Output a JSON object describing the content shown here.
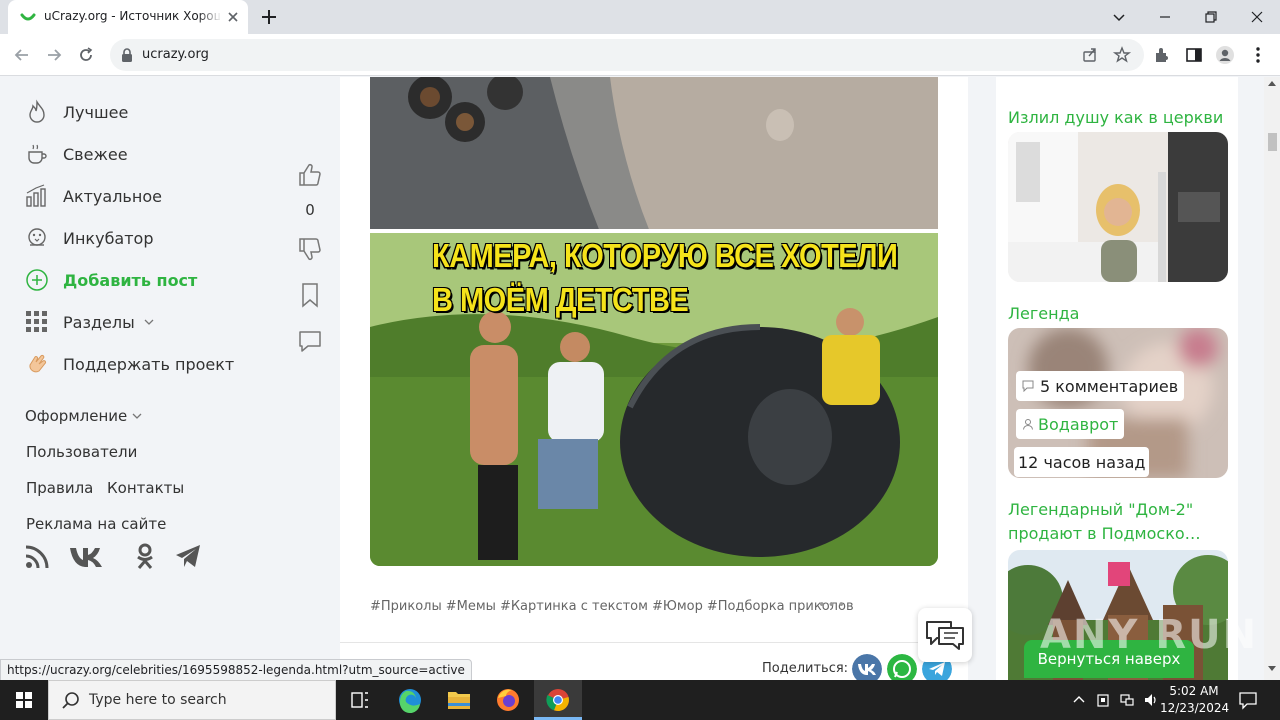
{
  "browser": {
    "tab_title": "uCrazy.org - Источник Хороше",
    "url": "ucrazy.org",
    "status_url": "https://ucrazy.org/celebrities/1695598852-legenda.html?utm_source=active"
  },
  "sidebar": {
    "items": [
      {
        "label": "Лучшее",
        "icon": "fire-icon"
      },
      {
        "label": "Свежее",
        "icon": "coffee-cup-icon"
      },
      {
        "label": "Актуальное",
        "icon": "bar-chart-icon"
      },
      {
        "label": "Инкубатор",
        "icon": "chick-icon"
      },
      {
        "label": "Добавить пост",
        "icon": "plus-circle-icon"
      },
      {
        "label": "Разделы",
        "icon": "grid-icon"
      },
      {
        "label": "Поддержать проект",
        "icon": "clap-hands-icon"
      }
    ],
    "design_label": "Оформление",
    "users_label": "Пользователи",
    "rules_label": "Правила",
    "contacts_label": "Контакты",
    "ads_label": "Реклама на сайте",
    "socials": [
      "rss-icon",
      "vk-icon",
      "odnoklassniki-icon",
      "telegram-icon"
    ]
  },
  "post": {
    "vote_count": "0",
    "caption_line1": "КАМЕРА, КОТОРУЮ ВСЕ ХОТЕЛИ",
    "caption_line2": "В МОЁМ ДЕТСТВЕ",
    "tags": [
      "#Приколы",
      "#Мемы",
      "#Картинка с текстом",
      "#Юмор",
      "#Подборка приколов"
    ],
    "more": "•••",
    "partial_count": "3",
    "share_label": "Поделиться:"
  },
  "right": {
    "item1_title": "Излил душу как в церкви",
    "item2_title": "Легенда",
    "item2_comments": "5 комментариев",
    "item2_author": "Водаврот",
    "item2_time": "12 часов назад",
    "item3_title": "Легендарный \"Дом-2\" продают в Подмоско…"
  },
  "overlay": {
    "back_to_top": "Вернуться наверх",
    "watermark": "ANY RUN"
  },
  "taskbar": {
    "search_placeholder": "Type here to search",
    "time": "5:02 AM",
    "date": "12/23/2024"
  },
  "colors": {
    "brand_green": "#2fb441",
    "caption_yellow": "#f5e31a"
  }
}
